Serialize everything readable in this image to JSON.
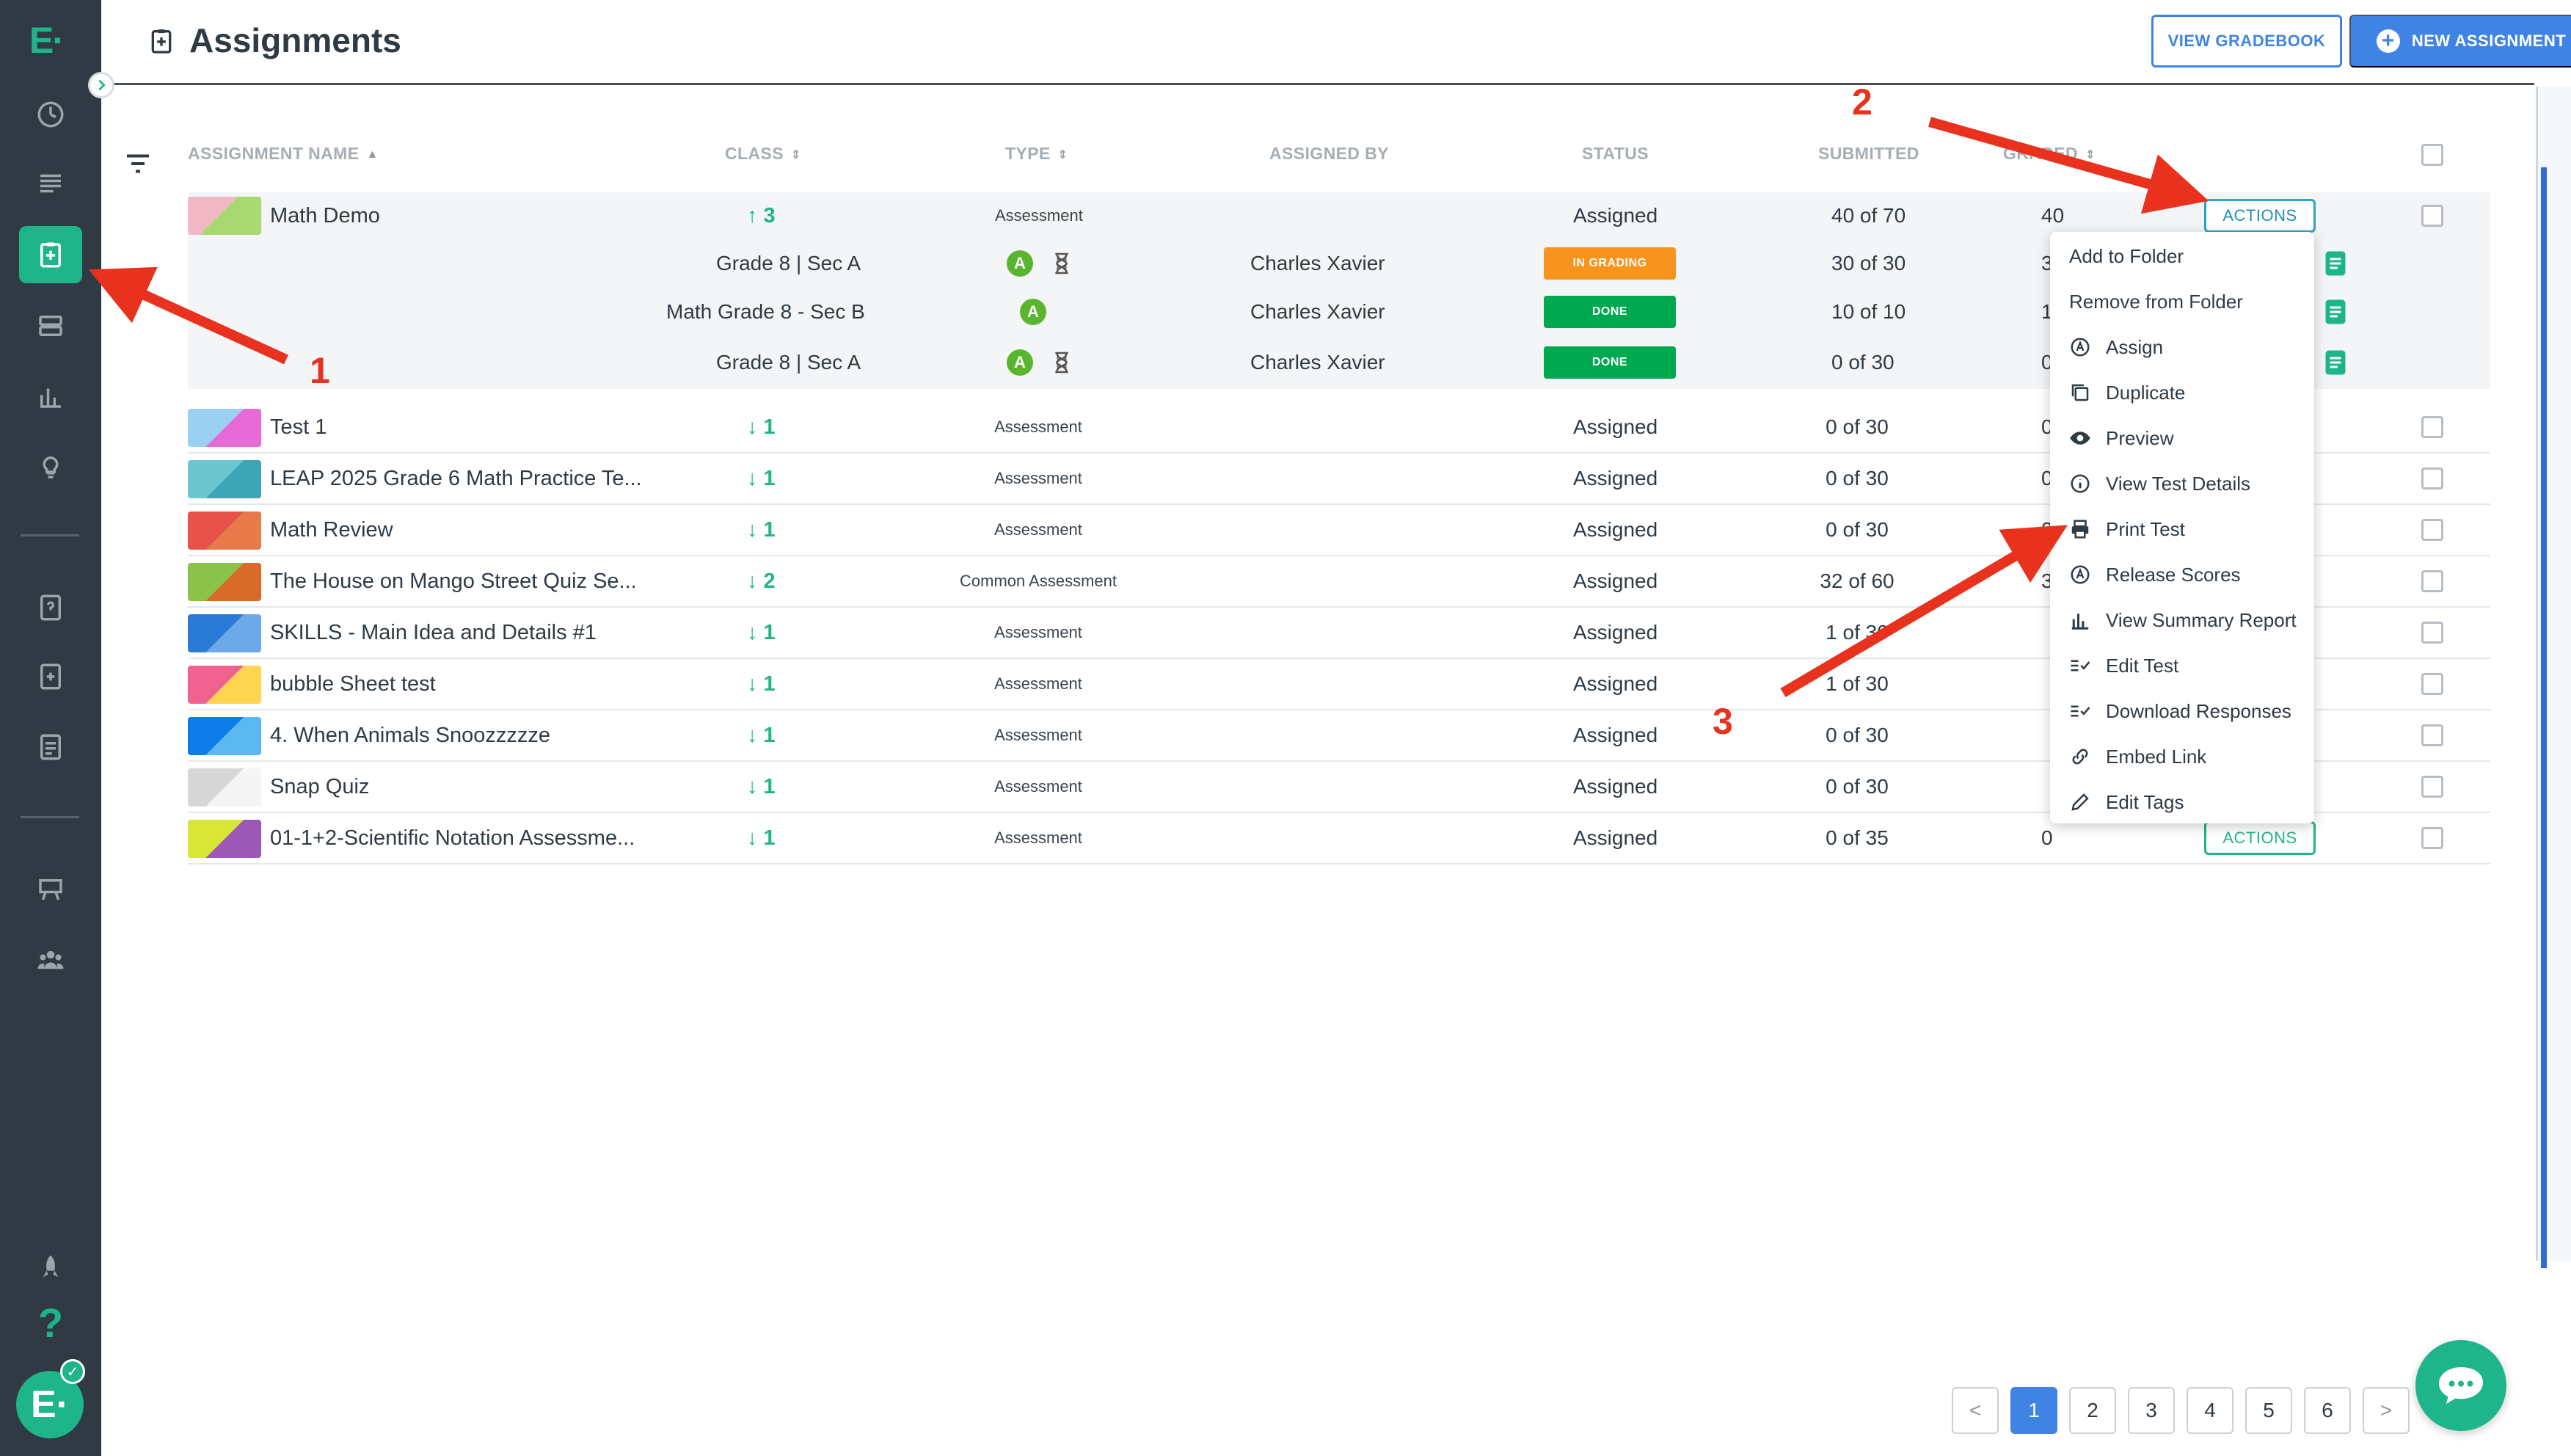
{
  "app": {
    "logo_text": "E·",
    "page_title": "Assignments"
  },
  "header": {
    "view_gradebook_label": "VIEW GRADEBOOK",
    "new_assignment_label": "NEW ASSIGNMENT"
  },
  "sidebar": {
    "icons": [
      "dashboard-icon",
      "list-icon",
      "assignments-icon",
      "layers-icon",
      "bar-chart-icon",
      "lightbulb-icon",
      "question-bank-icon",
      "test-bank-icon",
      "item-bank-icon",
      "classroom-icon",
      "students-icon",
      "rocket-icon",
      "help-icon"
    ],
    "help_glyph": "?",
    "avatar_text": "E·",
    "avatar_check": "✓"
  },
  "table": {
    "headers": {
      "name": "ASSIGNMENT NAME",
      "class": "CLASS",
      "type": "TYPE",
      "assigned_by": "ASSIGNED BY",
      "status": "STATUS",
      "submitted": "SUBMITTED",
      "graded": "GRADED"
    },
    "expanded": {
      "name": "Math Demo",
      "class_count": "↑ 3",
      "type": "Assessment",
      "status": "Assigned",
      "submitted": "40 of 70",
      "graded": "40",
      "actions_label": "ACTIONS",
      "sub_rows": [
        {
          "class": "Grade 8 | Sec A",
          "badge": "A",
          "teacher": "Charles Xavier",
          "status": "IN GRADING",
          "status_color": "#f7941d",
          "submitted": "30 of 30",
          "graded": "3"
        },
        {
          "class": "Math Grade 8 - Sec B",
          "badge": "A",
          "teacher": "Charles Xavier",
          "status": "DONE",
          "status_color": "#00a94f",
          "submitted": "10 of 10",
          "graded": "1"
        },
        {
          "class": "Grade 8 | Sec A",
          "badge": "A",
          "teacher": "Charles Xavier",
          "status": "DONE",
          "status_color": "#00a94f",
          "submitted": "0 of 30",
          "graded": "0"
        }
      ]
    },
    "rows": [
      {
        "name": "Test 1",
        "class_count": "↓ 1",
        "type": "Assessment",
        "status": "Assigned",
        "submitted": "0 of 30",
        "graded": "0"
      },
      {
        "name": "LEAP 2025 Grade 6 Math Practice Te...",
        "class_count": "↓ 1",
        "type": "Assessment",
        "status": "Assigned",
        "submitted": "0 of 30",
        "graded": "0"
      },
      {
        "name": "Math Review",
        "class_count": "↓ 1",
        "type": "Assessment",
        "status": "Assigned",
        "submitted": "0 of 30",
        "graded": "0"
      },
      {
        "name": "The House on Mango Street Quiz Se...",
        "class_count": "↓ 2",
        "type": "Common Assessment",
        "status": "Assigned",
        "submitted": "32 of 60",
        "graded": "3"
      },
      {
        "name": "SKILLS - Main Idea and Details #1",
        "class_count": "↓ 1",
        "type": "Assessment",
        "status": "Assigned",
        "submitted": "1 of 30",
        "graded": ""
      },
      {
        "name": "bubble Sheet test",
        "class_count": "↓ 1",
        "type": "Assessment",
        "status": "Assigned",
        "submitted": "1 of 30",
        "graded": ""
      },
      {
        "name": "4. When Animals Snoozzzzze",
        "class_count": "↓ 1",
        "type": "Assessment",
        "status": "Assigned",
        "submitted": "0 of 30",
        "graded": ""
      },
      {
        "name": "Snap Quiz",
        "class_count": "↓ 1",
        "type": "Assessment",
        "status": "Assigned",
        "submitted": "0 of 30",
        "graded": ""
      },
      {
        "name": "01-1+2-Scientific Notation Assessme...",
        "class_count": "↓ 1",
        "type": "Assessment",
        "status": "Assigned",
        "submitted": "0 of 35",
        "graded": "0",
        "actions_label": "ACTIONS"
      }
    ],
    "thumb_colors": [
      [
        "#f2b8c6",
        "#a8d870"
      ],
      [
        "#9ad0f2",
        "#e86ad6"
      ],
      [
        "#6cc6cf",
        "#3da5b5"
      ],
      [
        "#e8524a",
        "#e87a4a"
      ],
      [
        "#8bc34a",
        "#d86a2a"
      ],
      [
        "#2b7bd6",
        "#6da9e8"
      ],
      [
        "#f06292",
        "#ffd54f"
      ],
      [
        "#0d7be8",
        "#5cb8f0"
      ],
      [
        "#d6d6d6",
        "#f5f5f5"
      ],
      [
        "#d8e635",
        "#9b59b6"
      ]
    ]
  },
  "actions_menu": {
    "items": [
      {
        "label": "Add to Folder",
        "icon": "none"
      },
      {
        "label": "Remove from Folder",
        "icon": "none"
      },
      {
        "label": "Assign",
        "icon": "assign-icon"
      },
      {
        "label": "Duplicate",
        "icon": "duplicate-icon"
      },
      {
        "label": "Preview",
        "icon": "eye-icon"
      },
      {
        "label": "View Test Details",
        "icon": "info-icon"
      },
      {
        "label": "Print Test",
        "icon": "printer-icon"
      },
      {
        "label": "Release Scores",
        "icon": "release-icon"
      },
      {
        "label": "View Summary Report",
        "icon": "bar-chart-icon"
      },
      {
        "label": "Edit Test",
        "icon": "edit-list-icon"
      },
      {
        "label": "Download Responses",
        "icon": "download-list-icon"
      },
      {
        "label": "Embed Link",
        "icon": "link-icon"
      },
      {
        "label": "Edit Tags",
        "icon": "pencil-icon"
      }
    ]
  },
  "pagination": {
    "prev": "<",
    "pages": [
      "1",
      "2",
      "3",
      "4",
      "5",
      "6"
    ],
    "current": "1",
    "next": ">"
  },
  "annotations": {
    "labels": [
      "1",
      "2",
      "3"
    ],
    "color": "#e8321e"
  },
  "colors": {
    "sidebar_bg": "#2f3a44",
    "accent_green": "#1fb58a",
    "accent_blue": "#3f84e5"
  }
}
